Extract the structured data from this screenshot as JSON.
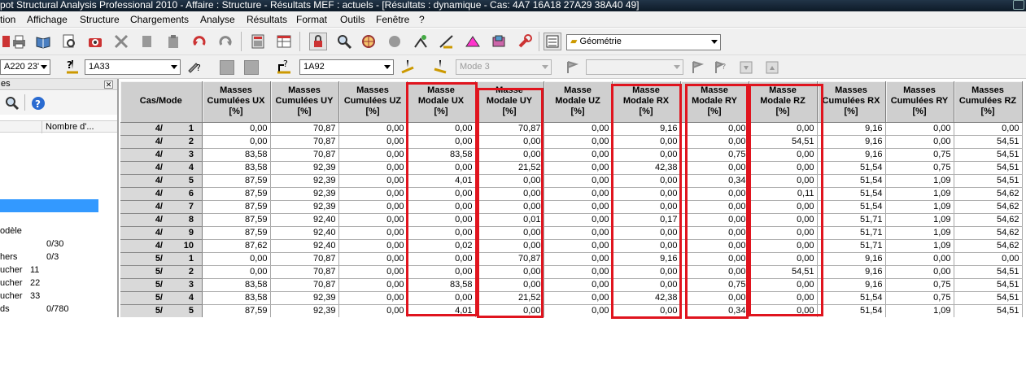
{
  "window": {
    "title": "pot Structural Analysis Professional 2010 - Affaire : Structure - Résultats MEF : actuels - [Résultats : dynamique - Cas:  4A7 16A18 27A29 38A40 49]"
  },
  "menu": {
    "items": [
      "tion",
      "Affichage",
      "Structure",
      "Chargements",
      "Analyse",
      "Résultats",
      "Format",
      "Outils",
      "Fenêtre",
      "?"
    ]
  },
  "toolbar": {
    "view_combo": "Géométrie",
    "case_combo": "A220 23'",
    "bar_combo": "1A33",
    "node_combo": "1A92",
    "mode_combo": "Mode  3",
    "empty_combo": ""
  },
  "left_panel": {
    "title": "es",
    "column_header": "Nombre d'...",
    "rows": [
      {
        "label": "odèle",
        "value": ""
      },
      {
        "label": "",
        "value": "0/30"
      },
      {
        "label": "hers",
        "value": "0/3"
      },
      {
        "label": "ucher",
        "value": "11"
      },
      {
        "label": "ucher",
        "value": "22"
      },
      {
        "label": "ucher",
        "value": "33"
      },
      {
        "label": "ds",
        "value": "0/780"
      }
    ]
  },
  "table": {
    "corner_header": "Cas/Mode",
    "columns": [
      [
        "Masses",
        "Cumulées UX",
        "[%]"
      ],
      [
        "Masses",
        "Cumulées UY",
        "[%]"
      ],
      [
        "Masses",
        "Cumulées UZ",
        "[%]"
      ],
      [
        "Masse",
        "Modale UX",
        "[%]"
      ],
      [
        "Masse",
        "Modale UY",
        "[%]"
      ],
      [
        "Masse",
        "Modale UZ",
        "[%]"
      ],
      [
        "Masse",
        "Modale RX",
        "[%]"
      ],
      [
        "Masse",
        "Modale RY",
        "[%]"
      ],
      [
        "Masse",
        "Modale RZ",
        "[%]"
      ],
      [
        "Masses",
        "Cumulées RX",
        "[%]"
      ],
      [
        "Masses",
        "Cumulées RY",
        "[%]"
      ],
      [
        "Masses",
        "Cumulées RZ",
        "[%]"
      ]
    ],
    "rows": [
      {
        "case": "4/",
        "mode": "1",
        "values": [
          "0,00",
          "70,87",
          "0,00",
          "0,00",
          "70,87",
          "0,00",
          "9,16",
          "0,00",
          "0,00",
          "9,16",
          "0,00",
          "0,00"
        ]
      },
      {
        "case": "4/",
        "mode": "2",
        "values": [
          "0,00",
          "70,87",
          "0,00",
          "0,00",
          "0,00",
          "0,00",
          "0,00",
          "0,00",
          "54,51",
          "9,16",
          "0,00",
          "54,51"
        ]
      },
      {
        "case": "4/",
        "mode": "3",
        "values": [
          "83,58",
          "70,87",
          "0,00",
          "83,58",
          "0,00",
          "0,00",
          "0,00",
          "0,75",
          "0,00",
          "9,16",
          "0,75",
          "54,51"
        ]
      },
      {
        "case": "4/",
        "mode": "4",
        "values": [
          "83,58",
          "92,39",
          "0,00",
          "0,00",
          "21,52",
          "0,00",
          "42,38",
          "0,00",
          "0,00",
          "51,54",
          "0,75",
          "54,51"
        ]
      },
      {
        "case": "4/",
        "mode": "5",
        "values": [
          "87,59",
          "92,39",
          "0,00",
          "4,01",
          "0,00",
          "0,00",
          "0,00",
          "0,34",
          "0,00",
          "51,54",
          "1,09",
          "54,51"
        ]
      },
      {
        "case": "4/",
        "mode": "6",
        "values": [
          "87,59",
          "92,39",
          "0,00",
          "0,00",
          "0,00",
          "0,00",
          "0,00",
          "0,00",
          "0,11",
          "51,54",
          "1,09",
          "54,62"
        ]
      },
      {
        "case": "4/",
        "mode": "7",
        "values": [
          "87,59",
          "92,39",
          "0,00",
          "0,00",
          "0,00",
          "0,00",
          "0,00",
          "0,00",
          "0,00",
          "51,54",
          "1,09",
          "54,62"
        ]
      },
      {
        "case": "4/",
        "mode": "8",
        "values": [
          "87,59",
          "92,40",
          "0,00",
          "0,00",
          "0,01",
          "0,00",
          "0,17",
          "0,00",
          "0,00",
          "51,71",
          "1,09",
          "54,62"
        ]
      },
      {
        "case": "4/",
        "mode": "9",
        "values": [
          "87,59",
          "92,40",
          "0,00",
          "0,00",
          "0,00",
          "0,00",
          "0,00",
          "0,00",
          "0,00",
          "51,71",
          "1,09",
          "54,62"
        ]
      },
      {
        "case": "4/",
        "mode": "10",
        "values": [
          "87,62",
          "92,40",
          "0,00",
          "0,02",
          "0,00",
          "0,00",
          "0,00",
          "0,00",
          "0,00",
          "51,71",
          "1,09",
          "54,62"
        ]
      },
      {
        "case": "5/",
        "mode": "1",
        "values": [
          "0,00",
          "70,87",
          "0,00",
          "0,00",
          "70,87",
          "0,00",
          "9,16",
          "0,00",
          "0,00",
          "9,16",
          "0,00",
          "0,00"
        ]
      },
      {
        "case": "5/",
        "mode": "2",
        "values": [
          "0,00",
          "70,87",
          "0,00",
          "0,00",
          "0,00",
          "0,00",
          "0,00",
          "0,00",
          "54,51",
          "9,16",
          "0,00",
          "54,51"
        ]
      },
      {
        "case": "5/",
        "mode": "3",
        "values": [
          "83,58",
          "70,87",
          "0,00",
          "83,58",
          "0,00",
          "0,00",
          "0,00",
          "0,75",
          "0,00",
          "9,16",
          "0,75",
          "54,51"
        ]
      },
      {
        "case": "5/",
        "mode": "4",
        "values": [
          "83,58",
          "92,39",
          "0,00",
          "0,00",
          "21,52",
          "0,00",
          "42,38",
          "0,00",
          "0,00",
          "51,54",
          "0,75",
          "54,51"
        ]
      },
      {
        "case": "5/",
        "mode": "5",
        "values": [
          "87,59",
          "92,39",
          "0,00",
          "4,01",
          "0,00",
          "0,00",
          "0,00",
          "0,34",
          "0,00",
          "51,54",
          "1,09",
          "54,51"
        ]
      }
    ]
  },
  "highlights": {
    "color": "#e0141e",
    "columns": [
      "Masse Modale UX",
      "Masse Modale UY",
      "Masse Modale RX",
      "Masse Modale RY",
      "Masse Modale RZ"
    ]
  },
  "colors": {
    "selection": "#3399ff",
    "header_bg": "#cfcfcf"
  }
}
